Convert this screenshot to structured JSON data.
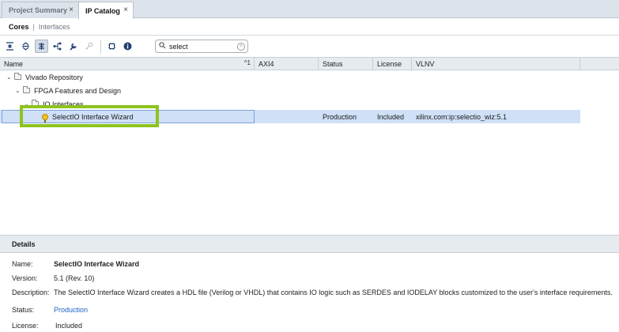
{
  "tabs": [
    {
      "label": "Project Summary",
      "close": "×"
    },
    {
      "label": "IP Catalog",
      "close": "×"
    }
  ],
  "subtabs": {
    "cores": "Cores",
    "separator": "|",
    "interfaces": "Interfaces"
  },
  "toolbar": {
    "icons": [
      "collapse-all-icon",
      "expand-all-icon",
      "filter-icon",
      "hierarchy-icon",
      "wrench-icon",
      "key-icon",
      "chip-icon",
      "info-icon"
    ],
    "search_value": "select"
  },
  "table": {
    "columns": [
      "Name",
      "AXI4",
      "Status",
      "License",
      "VLNV"
    ],
    "sort_indicator": "^1",
    "rows": [
      {
        "name": "Vivado Repository",
        "level": 0
      },
      {
        "name": "FPGA Features and Design",
        "level": 1
      },
      {
        "name": "IO Interfaces",
        "level": 2
      },
      {
        "name": "SelectIO Interface Wizard",
        "level": 3,
        "axi4": "",
        "status": "Production",
        "license": "Included",
        "vlnv": "xilinx.com:ip:selectio_wiz:5.1"
      }
    ]
  },
  "details": {
    "title": "Details",
    "name_label": "Name:",
    "name_value": "SelectIO Interface Wizard",
    "version_label": "Version:",
    "version_value": "5.1 (Rev. 10)",
    "description_label": "Description:",
    "description_value": "The SelectIO Interface Wizard creates a HDL file (Verilog or VHDL) that contains IO logic such as SERDES and IODELAY blocks customized to the user's interface requirements.",
    "status_label": "Status:",
    "status_value": "Production",
    "license_label": "License:",
    "license_value": "Included"
  },
  "colors": {
    "highlight": "#8ec31f",
    "selection": "#cfe0f7",
    "link": "#1a63c7"
  }
}
